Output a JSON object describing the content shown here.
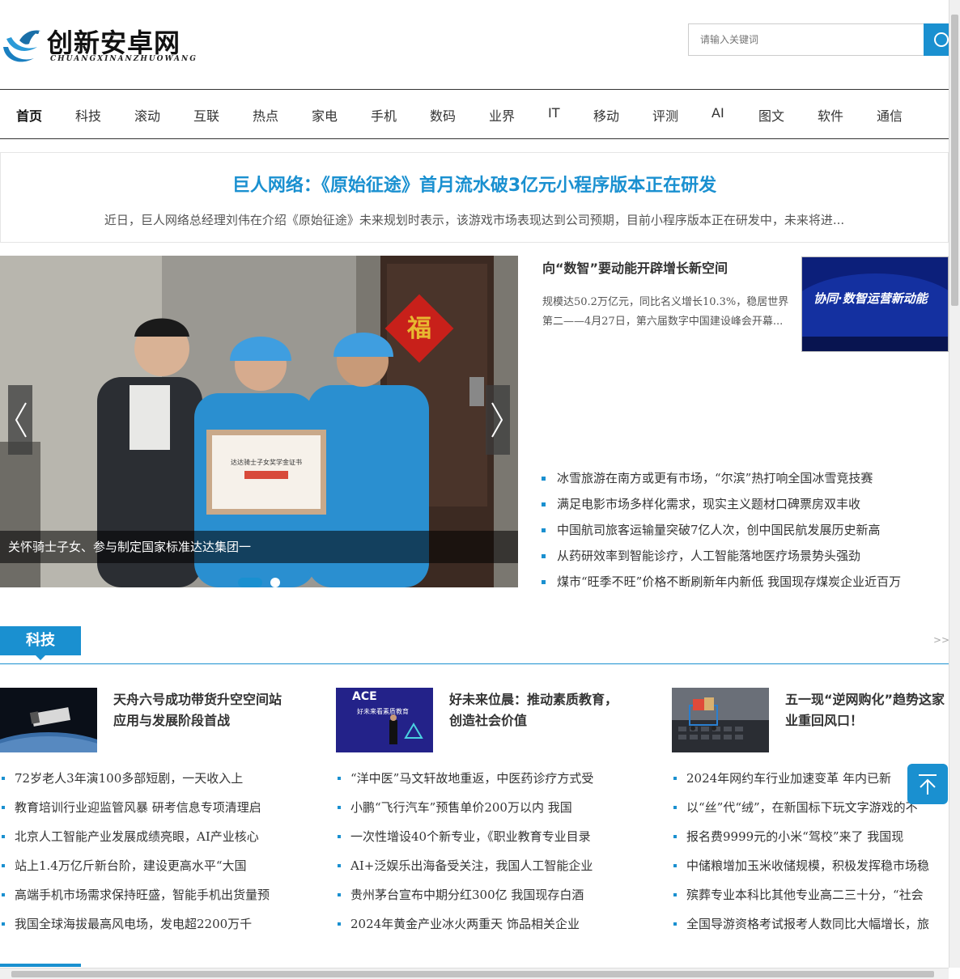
{
  "brand": {
    "name": "创新安卓网",
    "pinyin": "CHUANGXINANZHUOWANG"
  },
  "search": {
    "placeholder": "请输入关键词"
  },
  "nav": [
    "首页",
    "科技",
    "滚动",
    "互联",
    "热点",
    "家电",
    "手机",
    "数码",
    "业界",
    "IT",
    "移动",
    "评测",
    "AI",
    "图文",
    "软件",
    "通信"
  ],
  "headline": {
    "title": "巨人网络：《原始征途》首月流水破3亿元小程序版本正在研发",
    "summary": "近日，巨人网络总经理刘伟在介绍《原始征途》未来规划时表示，该游戏市场表现达到公司预期，目前小程序版本正在研发中，未来将进..."
  },
  "slider": {
    "caption": "关怀骑士子女、参与制定国家标准达达集团一",
    "active_slide": 1,
    "slide_count": 2,
    "certificate_text": "达达骑士子女奖学金证书",
    "fu_character": "福"
  },
  "feature": {
    "title": "向“数智”要动能开辟增长新空间",
    "summary": "规模达50.2万亿元，同比名义增长10.3%，稳居世界第二——4月27日，第六届数字中国建设峰会开幕...",
    "image_text": "协同·数智运营新动能"
  },
  "news_list": [
    "冰雪旅游在南方或更有市场，“尔滨”热打响全国冰雪竞技赛",
    "满足电影市场多样化需求，现实主义题材口碑票房双丰收",
    "中国航司旅客运输量突破7亿人次，创中国民航发展历史新高",
    "从药研效率到智能诊疗，人工智能落地医疗场景势头强劲",
    "煤市“旺季不旺”价格不断刷新年内新低 我国现存煤炭企业近百万"
  ],
  "section": {
    "title": "科技",
    "more": ">>",
    "columns": [
      {
        "title": "天舟六号成功带货升空空间站应用与发展阶段首战",
        "items": [
          "72岁老人3年演100多部短剧，一天收入上",
          "教育培训行业迎监管风暴 研考信息专项清理启",
          "北京人工智能产业发展成绩亮眼，AI产业核心",
          "站上1.4万亿斤新台阶，建设更高水平“大国",
          "高端手机市场需求保持旺盛，智能手机出货量预",
          "我国全球海拔最高风电场，发电超2200万千"
        ]
      },
      {
        "title": "好未来位晨：推动素质教育，创造社会价值",
        "thumb_text": "ACE",
        "thumb_sub": "好未来看素质教育",
        "items": [
          "“洋中医”马文轩故地重返，中医药诊疗方式受",
          "小鹏“飞行汽车”预售单价200万以内 我国",
          "一次性增设40个新专业，《职业教育专业目录",
          "AI+泛娱乐出海备受关注，我国人工智能企业",
          "贵州茅台宣布中期分红300亿 我国现存白酒",
          "2024年黄金产业冰火两重天 饰品相关企业"
        ]
      },
      {
        "title": "五一现“逆网购化”趋势这家业重回风口！",
        "items": [
          "2024年网约车行业加速变革 年内已新",
          "以“丝”代“绒”，在新国标下玩文字游戏的不",
          "报名费9999元的小米“驾校”来了 我国现",
          "中储粮增加玉米收储规模，积极发挥稳市场稳",
          "殡葬专业本科比其他专业高二三十分，“社会",
          "全国导游资格考试报考人数同比大幅增长，旅"
        ]
      }
    ]
  },
  "colors": {
    "accent": "#1a90d0",
    "text": "#333333"
  }
}
